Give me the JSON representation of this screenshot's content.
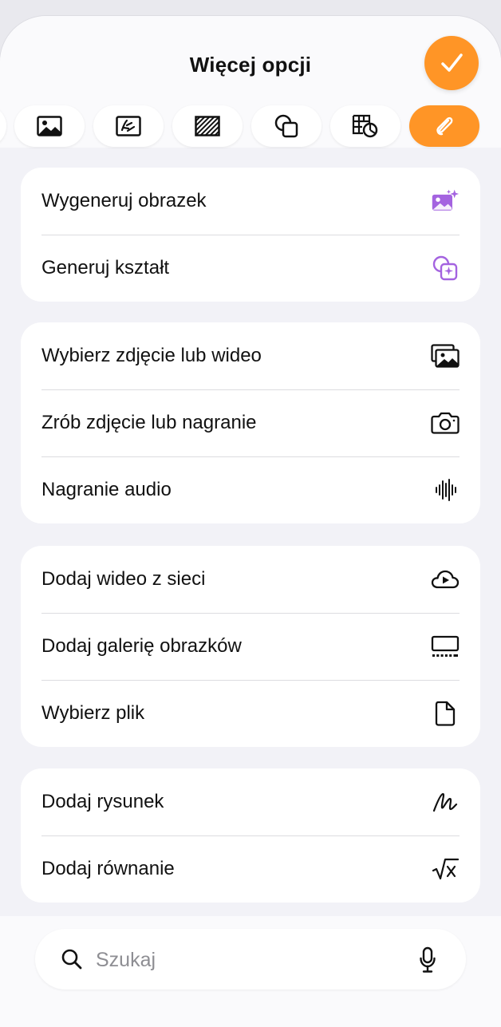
{
  "header": {
    "title": "Więcej opcji",
    "done_icon": "checkmark-icon"
  },
  "tabs": [
    {
      "icon": "photo-icon"
    },
    {
      "icon": "drawing-canvas-icon"
    },
    {
      "icon": "hatch-fill-icon"
    },
    {
      "icon": "shapes-icon"
    },
    {
      "icon": "table-chart-icon"
    },
    {
      "icon": "paperclip-icon",
      "active": true
    }
  ],
  "groups": [
    {
      "items": [
        {
          "label": "Wygeneruj obrazek",
          "icon": "image-sparkle-icon"
        },
        {
          "label": "Generuj kształt",
          "icon": "shape-sparkle-icon"
        }
      ]
    },
    {
      "items": [
        {
          "label": "Wybierz zdjęcie lub wideo",
          "icon": "photo-library-icon"
        },
        {
          "label": "Zrób zdjęcie lub nagranie",
          "icon": "camera-icon"
        },
        {
          "label": "Nagranie audio",
          "icon": "waveform-icon"
        }
      ]
    },
    {
      "items": [
        {
          "label": "Dodaj wideo z sieci",
          "icon": "cloud-play-icon"
        },
        {
          "label": "Dodaj galerię obrazków",
          "icon": "gallery-icon"
        },
        {
          "label": "Wybierz plik",
          "icon": "document-icon"
        }
      ]
    },
    {
      "items": [
        {
          "label": "Dodaj rysunek",
          "icon": "scribble-icon"
        },
        {
          "label": "Dodaj równanie",
          "icon": "square-root-icon"
        }
      ]
    }
  ],
  "search": {
    "placeholder": "Szukaj"
  },
  "colors": {
    "accent": "#ff9526",
    "ai_purple": "#a463e0"
  }
}
